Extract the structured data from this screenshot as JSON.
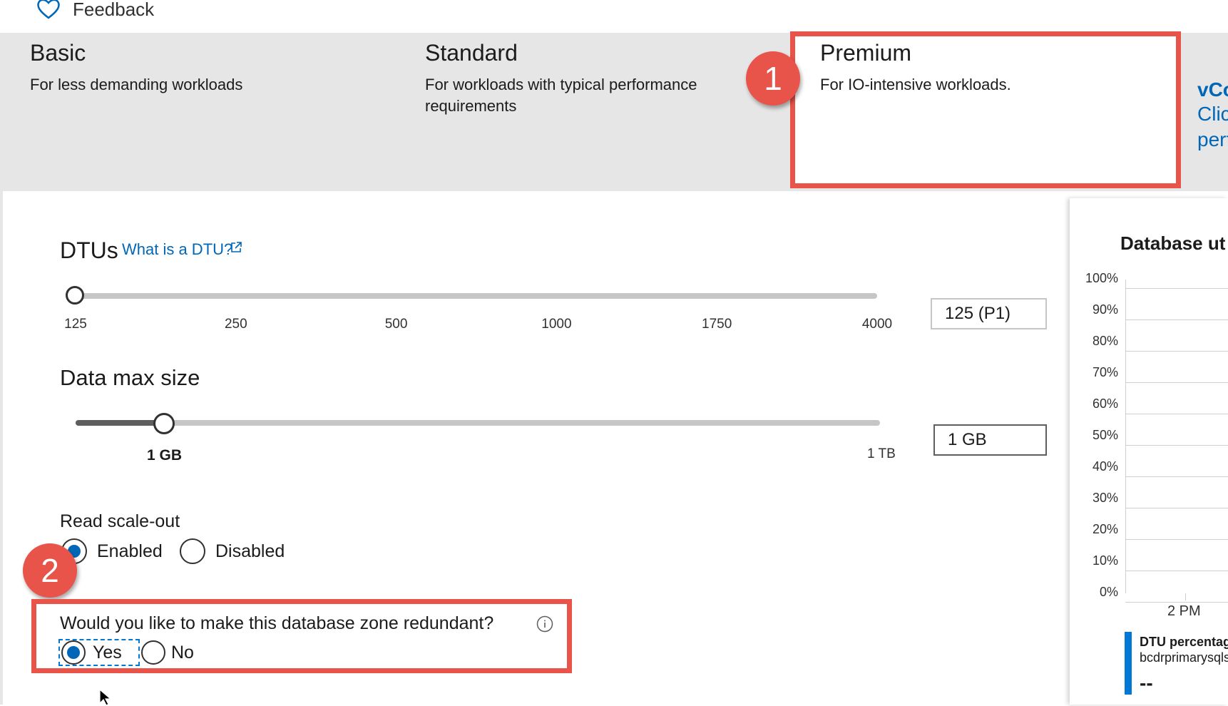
{
  "header": {
    "feedback_label": "Feedback",
    "feedback_icon": "heart-icon"
  },
  "tiers": {
    "basic": {
      "title": "Basic",
      "description": "For less demanding workloads"
    },
    "standard": {
      "title": "Standard",
      "description_line1": "For workloads with typical performance",
      "description_line2": "requirements"
    },
    "premium": {
      "title": "Premium",
      "description": "For IO-intensive workloads."
    },
    "vcore": {
      "line1": "vCo",
      "line2": "Clicl",
      "line3": "perf"
    }
  },
  "callouts": {
    "one": "1",
    "two": "2"
  },
  "dtu": {
    "title": "DTUs",
    "help_link": "What is a DTU?",
    "ticks": [
      "125",
      "250",
      "500",
      "1000",
      "1750",
      "4000"
    ],
    "selected_fraction": 0.0,
    "value": "125 (P1)"
  },
  "data_size": {
    "title": "Data max size",
    "current_label": "1 GB",
    "max_label": "1 TB",
    "selected_fraction": 0.11,
    "value": "1 GB"
  },
  "read_scale_out": {
    "title": "Read scale-out",
    "options": [
      "Enabled",
      "Disabled"
    ],
    "selected": "Enabled"
  },
  "zone_redundant": {
    "question": "Would you like to make this database zone redundant?",
    "options": [
      "Yes",
      "No"
    ],
    "selected": "Yes"
  },
  "utilization_panel": {
    "title": "Database ut",
    "y_ticks": [
      "100%",
      "90%",
      "80%",
      "70%",
      "60%",
      "50%",
      "40%",
      "30%",
      "20%",
      "10%",
      "0%"
    ],
    "x_ticks": [
      "2 PM"
    ],
    "legend_name": "DTU percentage",
    "legend_sub": "bcdrprimarysqls",
    "legend_value": "--"
  },
  "colors": {
    "accent": "#0067b8",
    "callout": "#e8534a",
    "band": "#e6e6e6"
  }
}
